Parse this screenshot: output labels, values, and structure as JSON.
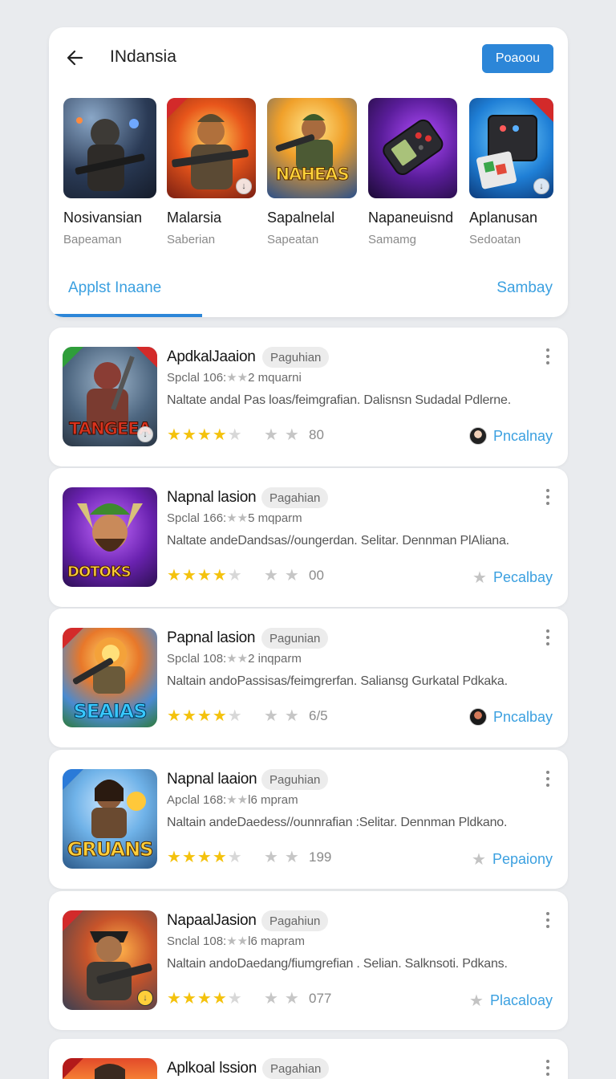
{
  "header": {
    "title": "INdansia",
    "primary_button": "Poaoou",
    "section_tab": "Applst Inaane",
    "section_link": "Sambay"
  },
  "featured": [
    {
      "name": "Nosivansian",
      "sub": "Bapeaman"
    },
    {
      "name": "Malarsia",
      "sub": "Saberian"
    },
    {
      "name": "Sapalnelal",
      "sub": "Sapeatan"
    },
    {
      "name": "Napaneuisnd",
      "sub": "Samamg"
    },
    {
      "name": "Aplanusan",
      "sub": "Sedoatan"
    }
  ],
  "featured_icon_text": {
    "f2": "NAHEAS"
  },
  "apps": [
    {
      "name": "ApdkalJaaion",
      "tag": "Paguhian",
      "meta": "Spclal 106:",
      "meta_suffix": "2 mquarni",
      "desc": "Naltate andal Pas loas/feimgrafian. Dalisnsn Sudadal Pdlerne.",
      "count": "80",
      "action": "Pncalnay",
      "icon_text": "TANGEEA"
    },
    {
      "name": "Napnal lasion",
      "tag": "Pagahian",
      "meta": "Spclal 166:",
      "meta_suffix": "5 mqparm",
      "desc": "Naltate andeDandsas//oungerdan. Selitar. Dennman PlAliana.",
      "count": "00",
      "action": "Pecalbay",
      "icon_text": "DOTOKS"
    },
    {
      "name": "Papnal lasion",
      "tag": "Pagunian",
      "meta": "Spclal 108:",
      "meta_suffix": "2 inqparm",
      "desc": "Naltain andoPassisas/feimgrerfan. Saliansg Gurkatal Pdkaka.",
      "count": "6/5",
      "action": "Pncalbay",
      "icon_text": "SEAIAS"
    },
    {
      "name": "Napnal laaion",
      "tag": "Paguhian",
      "meta": "Apclal 168:",
      "meta_suffix": "l6 mpram",
      "desc": "Naltain andeDaedess//ounnrafian :Selitar. Dennman Pldkano.",
      "count": "199",
      "action": "Pepaiony",
      "icon_text": "GRUANS"
    },
    {
      "name": "NapaalJasion",
      "tag": "Pagahiun",
      "meta": "Snclal 108:",
      "meta_suffix": "l6 mapram",
      "desc": "Naltain andoDaedang/fiumgrefian . Selian. Salknsoti.  Pdkans.",
      "count": "077",
      "action": "Placaloay",
      "icon_text": ""
    },
    {
      "name": "Aplkoal lssion",
      "tag": "Pagahian"
    }
  ]
}
